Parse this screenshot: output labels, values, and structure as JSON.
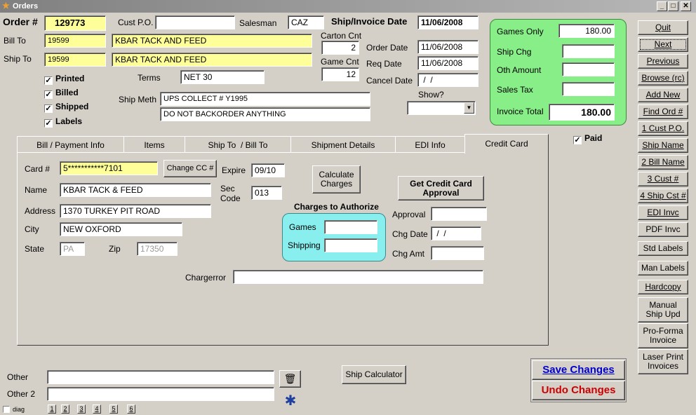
{
  "window": {
    "title": "Orders",
    "minimize": "_",
    "maximize": "□",
    "close": "✕"
  },
  "order": {
    "label": "Order #",
    "number": "129773",
    "bill_to_label": "Bill To",
    "bill_to_code": "19599",
    "bill_to_name": "KBAR TACK AND FEED",
    "ship_to_label": "Ship To",
    "ship_to_code": "19599",
    "ship_to_name": "KBAR TACK AND FEED",
    "cust_po_label": "Cust P.O.",
    "cust_po": "",
    "salesman_label": "Salesman",
    "salesman": "CAZ",
    "ship_invoice_date_label": "Ship/Invoice Date",
    "ship_invoice_date": "11/06/2008",
    "carton_cnt_label": "Carton Cnt",
    "carton_cnt": "2",
    "game_cnt_label": "Game Cnt",
    "game_cnt": "12",
    "order_date_label": "Order Date",
    "order_date": "11/06/2008",
    "req_date_label": "Req Date",
    "req_date": "11/06/2008",
    "cancel_date_label": "Cancel Date",
    "cancel_date": " /  /",
    "terms_label": "Terms",
    "terms": "NET 30",
    "ship_meth_label": "Ship Meth",
    "ship_meth": "UPS COLLECT # Y1995",
    "ship_note": "DO NOT BACKORDER ANYTHING",
    "show_label": "Show?",
    "show_value": ""
  },
  "checks": [
    {
      "label": "Printed",
      "checked": true
    },
    {
      "label": "Billed",
      "checked": true
    },
    {
      "label": "Shipped",
      "checked": true
    },
    {
      "label": "Labels",
      "checked": true
    }
  ],
  "totals": {
    "games_only_label": "Games Only",
    "games_only": "180.00",
    "ship_chg_label": "Ship Chg",
    "ship_chg": "",
    "oth_amount_label": "Oth Amount",
    "oth_amount": "",
    "sales_tax_label": "Sales Tax",
    "sales_tax": "",
    "invoice_total_label": "Invoice Total",
    "invoice_total": "180.00",
    "paid_label": "Paid",
    "paid": true
  },
  "tabs": [
    "Bill / Payment Info",
    "Items",
    "Ship To  / Bill To",
    "Shipment Details",
    "EDI Info",
    "Credit Card"
  ],
  "credit_card": {
    "card_label": "Card #",
    "card": "5***********7101",
    "change_cc_label": "Change CC #",
    "expire_label": "Expire",
    "expire": "09/10",
    "sec_code_label_1": "Sec",
    "sec_code_label_2": "Code",
    "sec_code": "013",
    "name_label": "Name",
    "name": "KBAR TACK & FEED",
    "address_label": "Address",
    "address": "1370 TURKEY PIT ROAD",
    "city_label": "City",
    "city": "NEW OXFORD",
    "state_label": "State",
    "state": "PA",
    "zip_label": "Zip",
    "zip": "17350",
    "calc_label_1": "Calculate",
    "calc_label_2": "Charges",
    "approval_btn_1": "Get Credit Card",
    "approval_btn_2": "Approval",
    "charges_title": "Charges to Authorize",
    "games_label": "Games",
    "games": "",
    "shipping_label": "Shipping",
    "shipping": "",
    "approval_label": "Approval",
    "approval": "",
    "chg_date_label": "Chg Date",
    "chg_date": " /  /",
    "chg_amt_label": "Chg Amt",
    "chg_amt": "",
    "chargerror_label": "Chargerror",
    "chargerror": ""
  },
  "nav": [
    "Quit",
    "Next",
    "Previous",
    "Browse (rc)",
    "Add New",
    "Find Ord #",
    "1 Cust P.O.",
    "Ship Name",
    "2 Bill Name",
    "3 Cust #",
    "4 Ship Cst #",
    "EDI Invc",
    "PDF Invc",
    "Std Labels",
    "Man Labels",
    "Hardcopy"
  ],
  "nav2": {
    "manual_1": "Manual",
    "manual_2": "Ship Upd",
    "proforma_1": "Pro-Forma",
    "proforma_2": "Invoice",
    "laser_1": "Laser Print",
    "laser_2": "Invoices"
  },
  "bottom": {
    "other_label": "Other",
    "other": "",
    "other2_label": "Other 2",
    "other2": "",
    "ship_calc_label": "Ship Calculator",
    "save_label": "Save Changes",
    "undo_label": "Undo Changes",
    "diag_label": "diag",
    "mini": [
      "1",
      "2",
      "3",
      "4",
      "5",
      "6"
    ]
  },
  "colors": {
    "save": "#0000cc",
    "undo": "#cc0000",
    "green_panel": "#88ee88",
    "cyan_panel": "#88eeee",
    "highlight": "#ffff99"
  }
}
